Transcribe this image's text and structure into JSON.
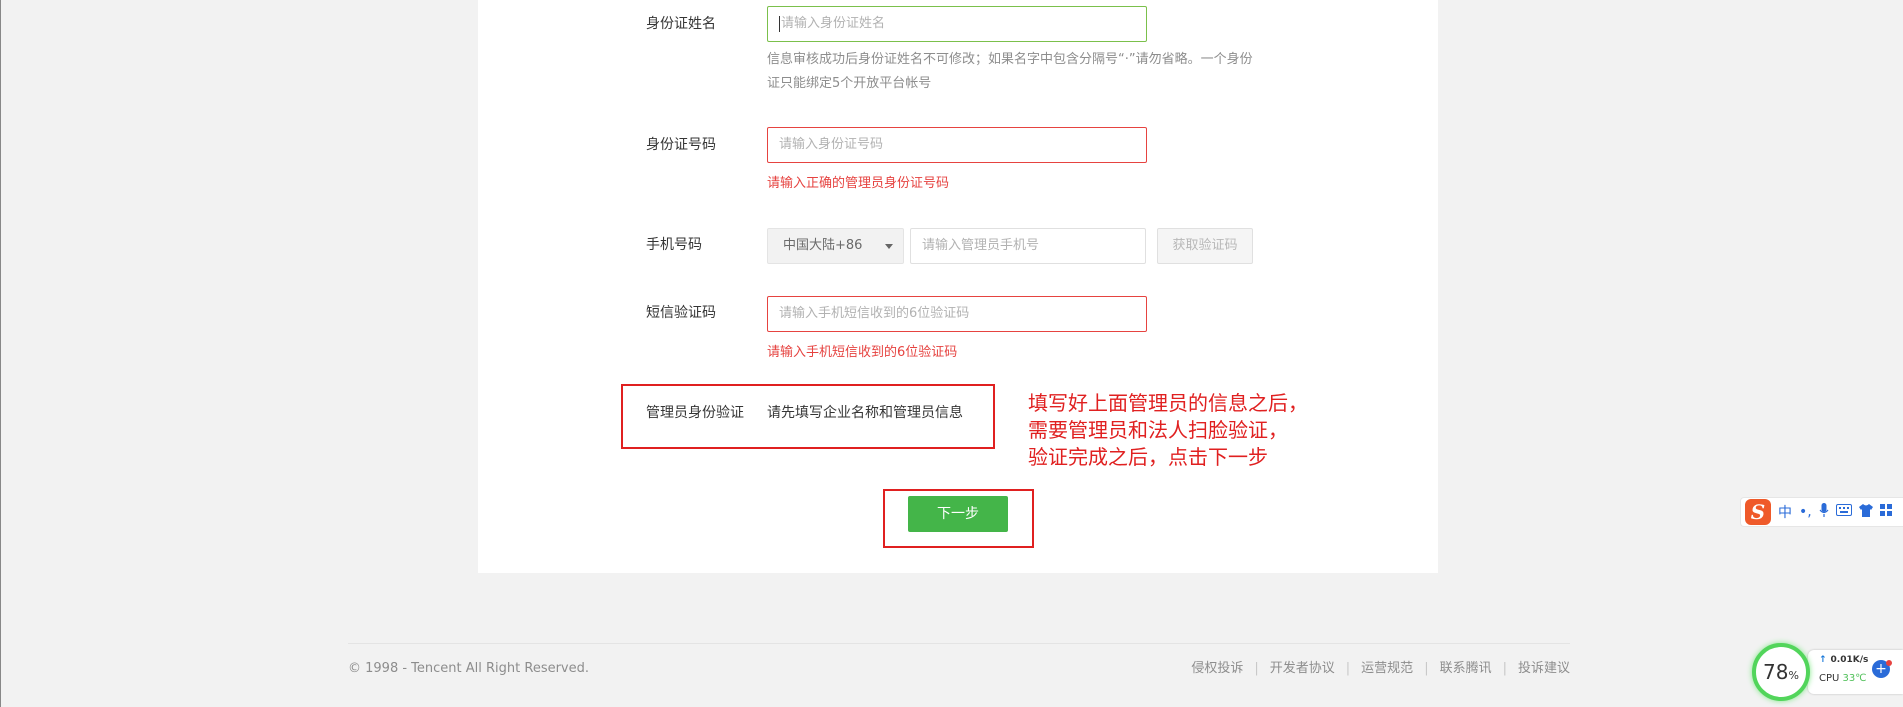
{
  "form": {
    "id_name": {
      "label": "身份证姓名",
      "placeholder": "请输入身份证姓名",
      "hint_line1": "信息审核成功后身份证姓名不可修改；如果名字中包含分隔号“·”请勿省略。一个身份",
      "hint_line2": "证只能绑定5个开放平台帐号"
    },
    "id_number": {
      "label": "身份证号码",
      "placeholder": "请输入身份证号码",
      "error": "请输入正确的管理员身份证号码"
    },
    "phone": {
      "label": "手机号码",
      "country_code": "中国大陆+86",
      "placeholder": "请输入管理员手机号",
      "get_code_button": "获取验证码"
    },
    "sms_code": {
      "label": "短信验证码",
      "placeholder": "请输入手机短信收到的6位验证码",
      "error": "请输入手机短信收到的6位验证码"
    },
    "admin_verify": {
      "label": "管理员身份验证",
      "text": "请先填写企业名称和管理员信息"
    },
    "next_button": "下一步"
  },
  "annotation": "填写好上面管理员的信息之后，\n需要管理员和法人扫脸验证，\n验证完成之后，点击下一步",
  "footer": {
    "copyright": "© 1998 - Tencent All Right Reserved.",
    "links": [
      "侵权投诉",
      "开发者协议",
      "运营规范",
      "联系腾讯",
      "投诉建议"
    ]
  },
  "ime_toolbar": {
    "logo": "S",
    "mode": "中",
    "punct": "•,",
    "icons": [
      "microphone-icon",
      "keyboard-icon",
      "shirt-icon",
      "grid-icon"
    ]
  },
  "cpu_widget": {
    "usage": "78",
    "usage_unit": "%",
    "upload_speed": "0.01K/s",
    "cpu_label": "CPU",
    "temperature": "33℃"
  },
  "colors": {
    "primary_green": "#44b549",
    "error_red": "#e64340",
    "annotation_red": "#e02020",
    "focus_green": "#7bc04b"
  }
}
